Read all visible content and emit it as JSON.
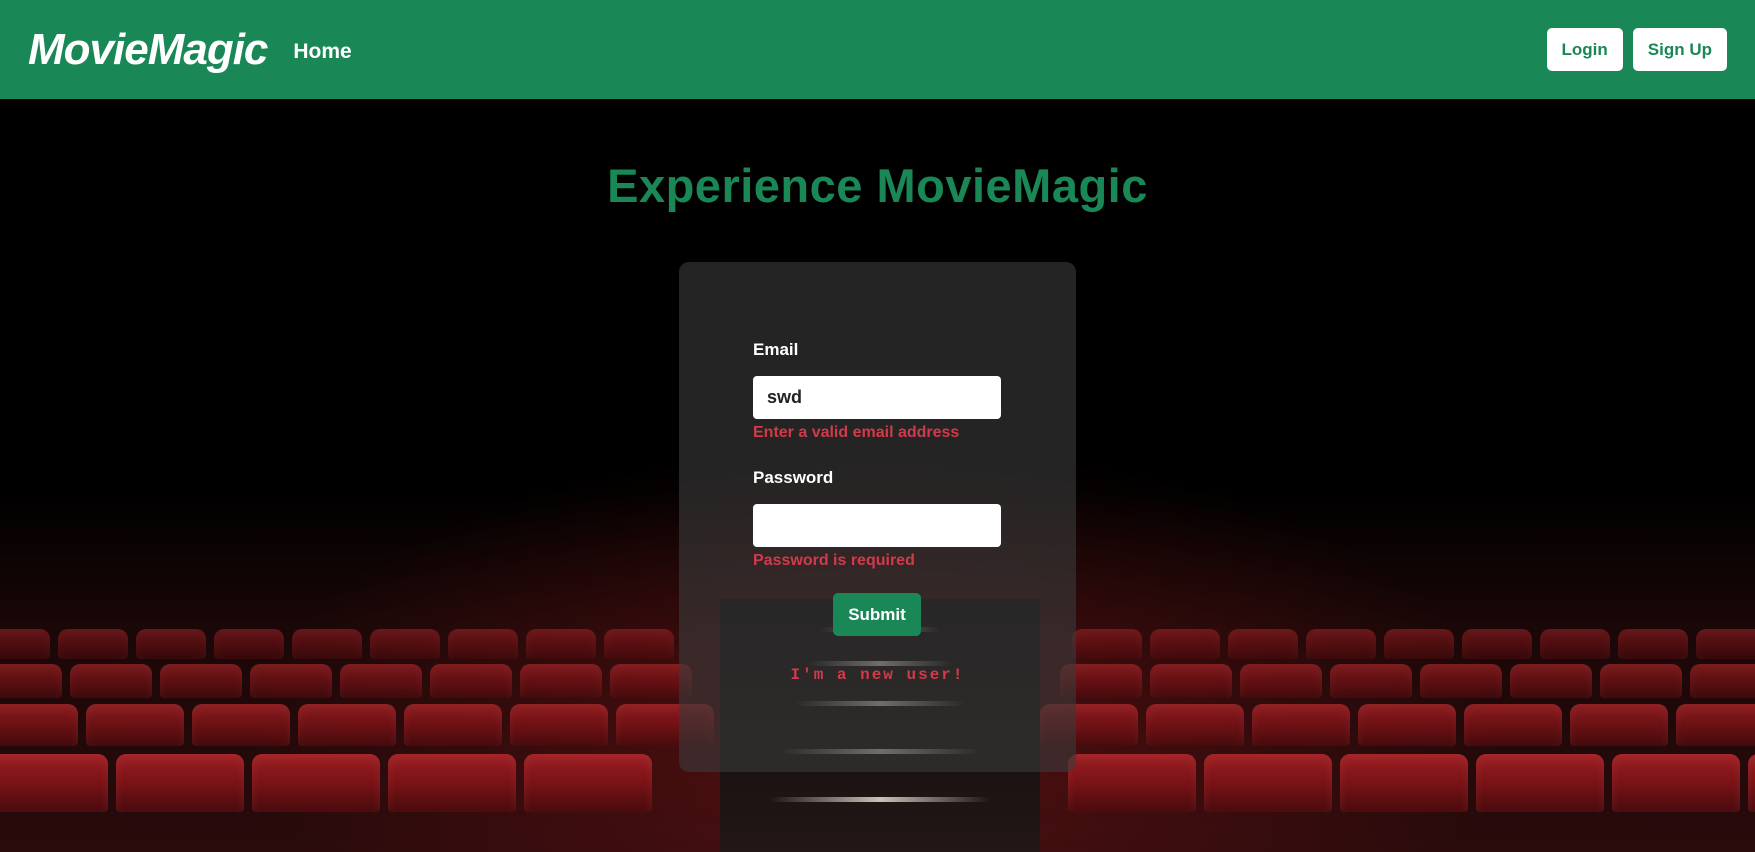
{
  "navbar": {
    "brand": "MovieMagic",
    "home_label": "Home",
    "login_label": "Login",
    "signup_label": "Sign Up"
  },
  "hero": {
    "title": "Experience MovieMagic"
  },
  "form": {
    "email_label": "Email",
    "email_value": "swd",
    "email_error": "Enter a valid email address",
    "password_label": "Password",
    "password_value": "",
    "password_error": "Password is required",
    "submit_label": "Submit",
    "new_user_link": "I'm a new user!"
  },
  "colors": {
    "brand_green": "#1a8856",
    "error_red": "#d13a4a",
    "card_bg": "#3a3a3a"
  }
}
